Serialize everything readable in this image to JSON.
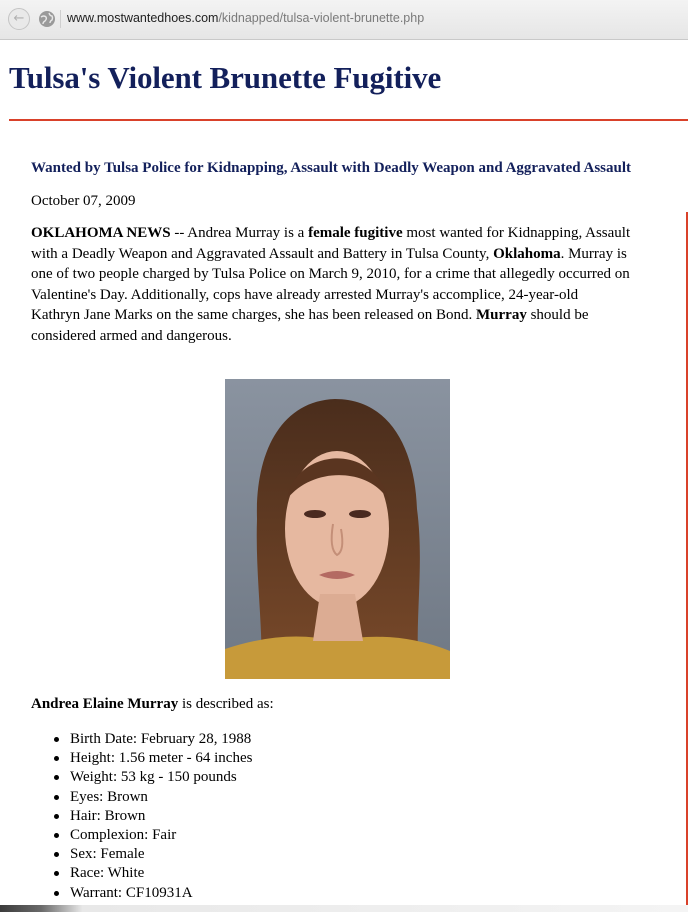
{
  "browser": {
    "url_domain": "www.mostwantedhoes.com",
    "url_path": "/kidnapped/tulsa-violent-brunette.php"
  },
  "page": {
    "title": "Tulsa's Violent Brunette Fugitive",
    "subtitle": "Wanted by Tulsa Police for Kidnapping, Assault with Deadly Weapon and Aggravated Assault",
    "date": "October 07, 2009",
    "article": [
      {
        "t": "OKLAHOMA NEWS",
        "b": true
      },
      {
        "t": " -- Andrea Murray is a ",
        "b": false
      },
      {
        "t": "female fugitive",
        "b": true
      },
      {
        "t": " most wanted for Kidnapping, Assault with a Deadly Weapon and Aggravated Assault and Battery in Tulsa County, ",
        "b": false
      },
      {
        "t": "Oklahoma",
        "b": true
      },
      {
        "t": ". Murray is one of two people charged by Tulsa Police on March 9, 2010, for a crime that allegedly occurred on Valentine's Day. Additionally, cops have already arrested Murray's accomplice, 24-year-old Kathryn Jane Marks on the same charges, she has been released on Bond. ",
        "b": false
      },
      {
        "t": "Murray",
        "b": true
      },
      {
        "t": " should be considered armed and dangerous.",
        "b": false
      }
    ],
    "described_name": "Andrea Elaine Murray",
    "described_suffix": " is described as:",
    "facts": [
      "Birth Date: February 28, 1988",
      "Height: 1.56 meter - 64 inches",
      "Weight: 53 kg - 150 pounds",
      "Eyes: Brown",
      "Hair: Brown",
      "Complexion: Fair",
      "Sex: Female",
      "Race: White",
      "Warrant: CF10931A"
    ]
  },
  "colors": {
    "title": "#13205b",
    "rule": "#d9412a"
  },
  "icons": {
    "back": "back-arrow-icon",
    "globe": "globe-icon"
  }
}
